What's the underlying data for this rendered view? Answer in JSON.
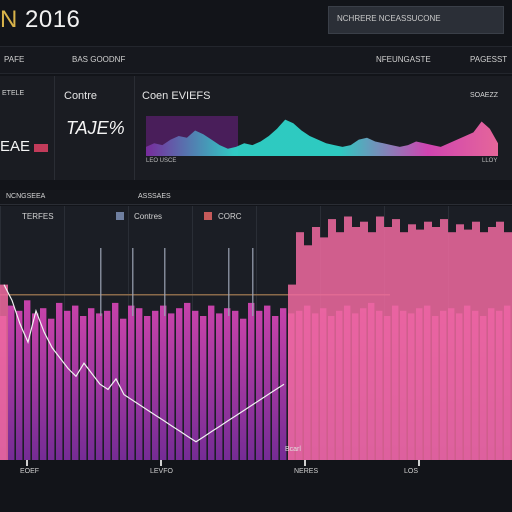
{
  "header": {
    "title_prefix": "N",
    "title_rest": " 2016",
    "search_placeholder": "NCHRERE NCEASSUCONE"
  },
  "menubar": {
    "items": [
      "PAFE",
      "BAS GOODNF",
      "NFEUNGASTE",
      "PAGESST"
    ]
  },
  "summary": {
    "left_label": "ETELE",
    "left_value": "EAE",
    "mid_label": "Contre",
    "mid_value": "TAJE%",
    "chart_label": "Coen EVIEFS",
    "right_label": "SOAEZZ",
    "foot_left": "LEO USCE",
    "foot_right": "LLOY"
  },
  "tabs": {
    "items": [
      "NCNGSEEA",
      "ASSSAES"
    ]
  },
  "legend": {
    "items": [
      {
        "label": "TERFES",
        "color": "#c7c7c7"
      },
      {
        "label": "Contres",
        "color": "#6f7fa0"
      },
      {
        "label": "CORC",
        "color": "#c55a5a"
      }
    ]
  },
  "axis": {
    "labels": [
      "EOEF",
      "LEVFO",
      "NERES",
      "LOS"
    ],
    "annotation": "Bcarl"
  },
  "colors": {
    "magenta": "#d946b8",
    "purple": "#7a2ca0",
    "cyan": "#2fd3c9",
    "pink": "#f06aa0",
    "accent_gold": "#d9b34a"
  },
  "chart_data": [
    {
      "type": "area",
      "title": "Coen EVIEFS",
      "x": [
        0,
        1,
        2,
        3,
        4,
        5,
        6,
        7,
        8,
        9,
        10,
        11,
        12,
        13,
        14,
        15,
        16,
        17,
        18,
        19,
        20,
        21,
        22,
        23,
        24,
        25,
        26,
        27,
        28,
        29,
        30,
        31,
        32,
        33,
        34,
        35,
        36,
        37,
        38,
        39,
        40,
        41,
        42,
        43
      ],
      "series": [
        {
          "name": "",
          "values": [
            10,
            14,
            12,
            18,
            22,
            20,
            28,
            24,
            18,
            12,
            8,
            10,
            14,
            12,
            16,
            22,
            30,
            40,
            36,
            28,
            22,
            18,
            14,
            12,
            10,
            12,
            18,
            20,
            16,
            14,
            12,
            10,
            12,
            16,
            14,
            12,
            10,
            14,
            18,
            22,
            26,
            38,
            30,
            14
          ]
        }
      ]
    },
    {
      "type": "bar",
      "title": "",
      "x": [
        0,
        1,
        2,
        3,
        4,
        5,
        6,
        7,
        8,
        9,
        10,
        11,
        12,
        13,
        14,
        15,
        16,
        17,
        18,
        19,
        20,
        21,
        22,
        23,
        24,
        25,
        26,
        27,
        28,
        29,
        30,
        31,
        32,
        33,
        34,
        35,
        36,
        37,
        38,
        39,
        40,
        41,
        42,
        43,
        44,
        45,
        46,
        47,
        48,
        49,
        50,
        51,
        52,
        53,
        54,
        55,
        56,
        57,
        58,
        59,
        60,
        61,
        62,
        63
      ],
      "series": [
        {
          "name": "",
          "values": [
            58,
            62,
            60,
            64,
            59,
            61,
            57,
            63,
            60,
            62,
            58,
            61,
            59,
            60,
            63,
            57,
            62,
            61,
            58,
            60,
            62,
            59,
            61,
            63,
            60,
            58,
            62,
            59,
            61,
            60,
            57,
            63,
            60,
            62,
            58,
            61,
            59,
            60,
            62,
            59,
            61,
            58,
            60,
            62,
            59,
            61,
            63,
            60,
            58,
            62,
            60,
            59,
            61,
            62,
            58,
            60,
            61,
            59,
            62,
            60,
            58,
            61,
            60,
            62
          ]
        },
        {
          "name": "",
          "values": [
            70,
            64,
            55,
            48,
            60,
            52,
            46,
            42,
            38,
            35,
            40,
            36,
            32,
            30,
            34,
            28,
            26,
            24,
            22,
            20,
            18,
            16,
            14,
            12,
            10,
            12,
            14,
            16,
            18,
            20,
            22,
            24,
            26,
            28,
            30,
            32,
            70,
            90,
            85,
            92,
            88,
            95,
            90,
            96,
            92,
            94,
            90,
            96,
            92,
            95,
            90,
            93,
            91,
            94,
            92,
            95,
            90,
            93,
            91,
            94,
            90,
            92,
            94,
            90
          ]
        }
      ]
    }
  ]
}
